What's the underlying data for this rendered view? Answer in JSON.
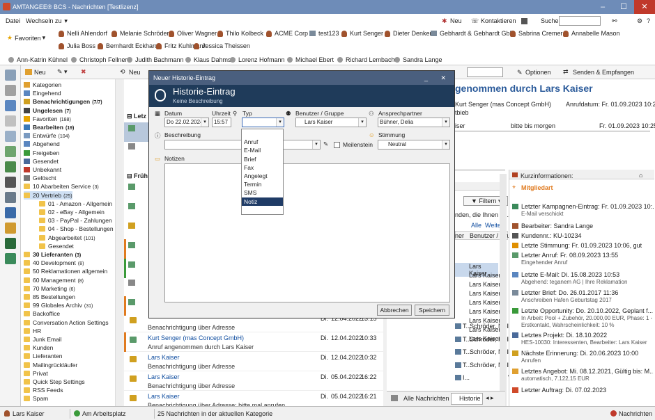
{
  "window": {
    "title": "AMTANGEE® BCS - Nachrichten [Testlizenz]"
  },
  "menu": {
    "datei": "Datei",
    "wechseln": "Wechseln zu",
    "neu": "Neu",
    "kontaktieren": "Kontaktieren",
    "suchen": "Suchen"
  },
  "favorites": {
    "label": "Favoriten",
    "row1": [
      "Nelli Ahlendorf",
      "Melanie Schröder",
      "Oliver Wagner",
      "Thilo Kolbeck",
      "ACME Corp",
      "test123",
      "Kurt Senger",
      "Dieter Denker",
      "Gebhardt & Gebhardt GbR",
      "Sabrina Cremer",
      "Annabelle Mason"
    ],
    "row2": [
      "Julia Boss",
      "Bernhardt Eckhard",
      "Fritz Kuhlmann",
      "Jessica Theissen"
    ]
  },
  "recent": [
    "Ann-Katrin Kühnel",
    "Christoph Fellner",
    "Judith Bachmann",
    "Klaus Dahms",
    "Lorenz Hofmann",
    "Michael Ebert",
    "Richard Lembach",
    "Sandra Lange"
  ],
  "toolbar": {
    "neu": "Neu",
    "optionen": "Optionen",
    "senden": "Senden & Empfangen"
  },
  "tree": [
    {
      "t": "Kategorien",
      "c": "",
      "b": false,
      "lvl": 0
    },
    {
      "t": "Eingehend",
      "c": "",
      "b": false,
      "lvl": 0
    },
    {
      "t": "Benachrichtigungen",
      "c": "(7/7)",
      "b": true,
      "lvl": 0
    },
    {
      "t": "Ungelesen",
      "c": "(7)",
      "b": true,
      "lvl": 0
    },
    {
      "t": "Favoriten",
      "c": "(188)",
      "b": false,
      "lvl": 0
    },
    {
      "t": "Bearbeiten",
      "c": "(19)",
      "b": true,
      "lvl": 0
    },
    {
      "t": "Entwürfe",
      "c": "(104)",
      "b": false,
      "lvl": 0
    },
    {
      "t": "Abgehend",
      "c": "",
      "b": false,
      "lvl": 0
    },
    {
      "t": "Freigeben",
      "c": "",
      "b": false,
      "lvl": 0
    },
    {
      "t": "Gesendet",
      "c": "",
      "b": false,
      "lvl": 0
    },
    {
      "t": "Unbekannt",
      "c": "",
      "b": false,
      "lvl": 0
    },
    {
      "t": "Gelöscht",
      "c": "",
      "b": false,
      "lvl": 0
    },
    {
      "t": "10 Abarbeiten Service",
      "c": "(3)",
      "b": false,
      "lvl": 0
    },
    {
      "t": "20 Vertrieb",
      "c": "(25)",
      "b": false,
      "lvl": 0
    },
    {
      "t": "01 - Amazon - Allgemein",
      "c": "",
      "b": false,
      "lvl": 1
    },
    {
      "t": "02 - eBay - Allgemein",
      "c": "",
      "b": false,
      "lvl": 1
    },
    {
      "t": "03 - PayPal - Zahlungen",
      "c": "",
      "b": false,
      "lvl": 1
    },
    {
      "t": "04 - Shop - Bestellungen",
      "c": "",
      "b": false,
      "lvl": 1
    },
    {
      "t": "Abgearbeitet",
      "c": "(101)",
      "b": false,
      "lvl": 1
    },
    {
      "t": "Gesendet",
      "c": "",
      "b": false,
      "lvl": 1
    },
    {
      "t": "30 Lieferanten",
      "c": "(3)",
      "b": true,
      "lvl": 0
    },
    {
      "t": "40 Development",
      "c": "(8)",
      "b": false,
      "lvl": 0
    },
    {
      "t": "50 Reklamationen allgemein",
      "c": "",
      "b": false,
      "lvl": 0
    },
    {
      "t": "60 Management",
      "c": "(8)",
      "b": false,
      "lvl": 0
    },
    {
      "t": "70 Marketing",
      "c": "(6)",
      "b": false,
      "lvl": 0
    },
    {
      "t": "85 Bestellungen",
      "c": "",
      "b": false,
      "lvl": 0
    },
    {
      "t": "99 Globales Archiv",
      "c": "(31)",
      "b": false,
      "lvl": 0
    },
    {
      "t": "Backoffice",
      "c": "",
      "b": false,
      "lvl": 0
    },
    {
      "t": "Conversation Action Settings",
      "c": "",
      "b": false,
      "lvl": 0
    },
    {
      "t": "HR",
      "c": "",
      "b": false,
      "lvl": 0
    },
    {
      "t": "Junk Email",
      "c": "",
      "b": false,
      "lvl": 0
    },
    {
      "t": "Kunden",
      "c": "",
      "b": false,
      "lvl": 0
    },
    {
      "t": "Lieferanten",
      "c": "",
      "b": false,
      "lvl": 0
    },
    {
      "t": "Mailingrückläufer",
      "c": "",
      "b": false,
      "lvl": 0
    },
    {
      "t": "Privat",
      "c": "",
      "b": false,
      "lvl": 0
    },
    {
      "t": "Quick Step Settings",
      "c": "",
      "b": false,
      "lvl": 0
    },
    {
      "t": "RSS Feeds",
      "c": "",
      "b": false,
      "lvl": 0
    },
    {
      "t": "Spam",
      "c": "",
      "b": false,
      "lvl": 0
    }
  ],
  "list": {
    "group1": "Letz",
    "group2": "Früh",
    "rows": [
      {
        "n1": "",
        "n2": "Benachrichtigung über Adresse",
        "d": "Di.",
        "dt": "12.04.2022",
        "tm": "13:15"
      },
      {
        "n1": "Kurt Senger (mas Concept GmbH)",
        "n2": "Anruf angenommen durch Lars Kaiser",
        "d": "Di.",
        "dt": "12.04.2022",
        "tm": "10:33"
      },
      {
        "n1": "Lars Kaiser",
        "n2": "Benachrichtigung über Adresse",
        "d": "Di.",
        "dt": "12.04.2022",
        "tm": "10:32"
      },
      {
        "n1": "Lars Kaiser",
        "n2": "Benachrichtigung über Adresse",
        "d": "Di.",
        "dt": "05.04.2022",
        "tm": "16:22"
      },
      {
        "n1": "Lars Kaiser",
        "n2": "Benachrichtigung über Adresse: bitte mal anrufen",
        "d": "Di.",
        "dt": "05.04.2022",
        "tm": "16:21"
      }
    ]
  },
  "detail": {
    "title": "genommen durch Lars Kaiser",
    "from": "Kurt Senger (mas Concept GmbH)",
    "anrufdatum": "Anrufdatum: Fr. 01.09.2023 10:22",
    "vertrieb": "tbieb",
    "row_iser": "iser",
    "row_bitte": "bitte bis morgen",
    "row_date": "Fr. 01.09.2023 10:25"
  },
  "midpanel": {
    "filter": "Filtern",
    "snippet": "nden, die Ihnen a...",
    "alle": "Alle",
    "weitere": "Weitere",
    "col1": "ner",
    "col2": "Benutzer / Grupp",
    "rows": [
      "Lars Kaiser",
      "Lars Kaiser",
      "Lars Kaiser",
      "Lars Kaiser",
      "Lars Kaiser",
      "Lars Kaiser",
      "Lars Kaiser",
      "Lars Kaiser",
      "Lars Kaiser"
    ],
    "trows": [
      {
        "a": "T...",
        "b": "Schröder, Mela...",
        "c": "Lars Kaiser"
      },
      {
        "a": "T...",
        "b": "Schröder, Mela...",
        "c": "Lars Kaiser"
      },
      {
        "a": "T...",
        "b": "Schröder, Mela...",
        "c": "Lars Kaiser"
      },
      {
        "a": "T...",
        "b": "Schröder, Mela...",
        "c": "Lars Kaiser"
      },
      {
        "a": "I...",
        "b": "",
        "c": "Vertrieb"
      }
    ],
    "tab1": "Alle Nachrichten",
    "tab2": "Historie"
  },
  "info": {
    "title": "Kurzinformationen:",
    "mitgliedart": "Mitgliedart",
    "items": [
      {
        "t": "Letzter Kampagnen-Eintrag: Fr. 01.09.2023 10:...",
        "s": "E-Mail verschickt"
      },
      {
        "t": "Bearbeiter: Sandra Lange",
        "s": ""
      },
      {
        "t": "Kundennr.: KU-10234",
        "s": ""
      },
      {
        "t": "Letzte Stimmung: Fr. 01.09.2023 10:06, gut",
        "s": ""
      },
      {
        "t": "Letzter Anruf: Fr. 08.09.2023 13:55",
        "s": "Eingehender Anruf"
      },
      {
        "t": "Letzte E-Mail: Di. 15.08.2023 10:53",
        "s": "Abgehend: teganem AG | Ihre Reklamation"
      },
      {
        "t": "Letzter Brief: Do. 26.01.2017 11:36",
        "s": "Anschreiben Hafen Geburtstag 2017"
      },
      {
        "t": "Letzte Opportunity: Do. 20.10.2022, Geplant f...",
        "s": "In Arbeit: Pool + Zubehör, 20.000,00 EUR, Phase: 1 - Erstkontakt, Wahrscheinlichkeit: 10 %"
      },
      {
        "t": "Letztes Projekt: Di. 18.10.2022",
        "s": "HES-10030: Interessenten, Bearbeiter: Lars Kaiser"
      },
      {
        "t": "Nächste Erinnerung: Di. 20.06.2023 10:00",
        "s": "Anrufen"
      },
      {
        "t": "Letztes Angebot: Mi. 08.12.2021, Gültig bis: M...",
        "s": "automatisch, 7.122,15 EUR"
      },
      {
        "t": "Letzter Auftrag: Di. 07.02.2023",
        "s": ""
      }
    ]
  },
  "status": {
    "user": "Lars Kaiser",
    "place": "Am Arbeitsplatz",
    "count": "25 Nachrichten in der aktuellen Kategorie",
    "nachrichten": "Nachrichten"
  },
  "dialog": {
    "wintitle": "Neuer Historie-Eintrag",
    "title": "Historie-Eintrag",
    "subtitle": "Keine Beschreibung",
    "datum_lbl": "Datum",
    "datum": "Do 22.02.2024",
    "uhrzeit_lbl": "Uhrzeit",
    "uhrzeit": "15:57",
    "typ_lbl": "Typ",
    "typ": "",
    "benutzer_lbl": "Benutzer / Gruppe",
    "benutzer": "Lars Kaiser",
    "ansprech_lbl": "Ansprechpartner",
    "ansprech": "Bühner, Delia",
    "beschreibung_lbl": "Beschreibung",
    "meilenstein": "Meilenstein",
    "stimmung_lbl": "Stimmung",
    "stimmung": "Neutral",
    "notizen_lbl": "Notizen",
    "abbrechen": "Abbrechen",
    "speichern": "Speichern",
    "typ_options": [
      "",
      "Anruf",
      "E-Mail",
      "Brief",
      "Fax",
      "Angelegt",
      "Termin",
      "SMS",
      "Notiz"
    ],
    "selected": "Notiz"
  }
}
